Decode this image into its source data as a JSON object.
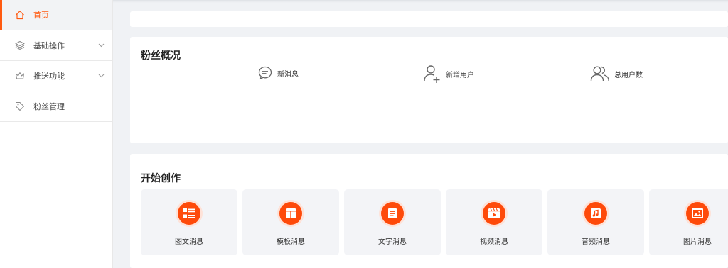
{
  "colors": {
    "accent": "#ff5a10",
    "icon_fill": "#fe4a0a"
  },
  "sidebar": {
    "items": [
      {
        "label": "首页",
        "icon": "home-icon",
        "active": true
      },
      {
        "label": "基础操作",
        "icon": "layers-icon",
        "expandable": true
      },
      {
        "label": "推送功能",
        "icon": "crown-icon",
        "expandable": true
      },
      {
        "label": "粉丝管理",
        "icon": "tag-icon"
      }
    ]
  },
  "fans_overview": {
    "title": "粉丝概况",
    "stats": [
      {
        "label": "新消息",
        "icon": "chat-icon"
      },
      {
        "label": "新增用户",
        "icon": "add-user-icon"
      },
      {
        "label": "总用户数",
        "icon": "users-icon"
      }
    ]
  },
  "create": {
    "title": "开始创作",
    "cards": [
      {
        "label": "图文消息",
        "icon": "list-icon"
      },
      {
        "label": "模板消息",
        "icon": "template-icon"
      },
      {
        "label": "文字消息",
        "icon": "text-doc-icon"
      },
      {
        "label": "视频消息",
        "icon": "video-icon"
      },
      {
        "label": "音频消息",
        "icon": "music-icon"
      },
      {
        "label": "图片消息",
        "icon": "image-icon"
      }
    ]
  }
}
